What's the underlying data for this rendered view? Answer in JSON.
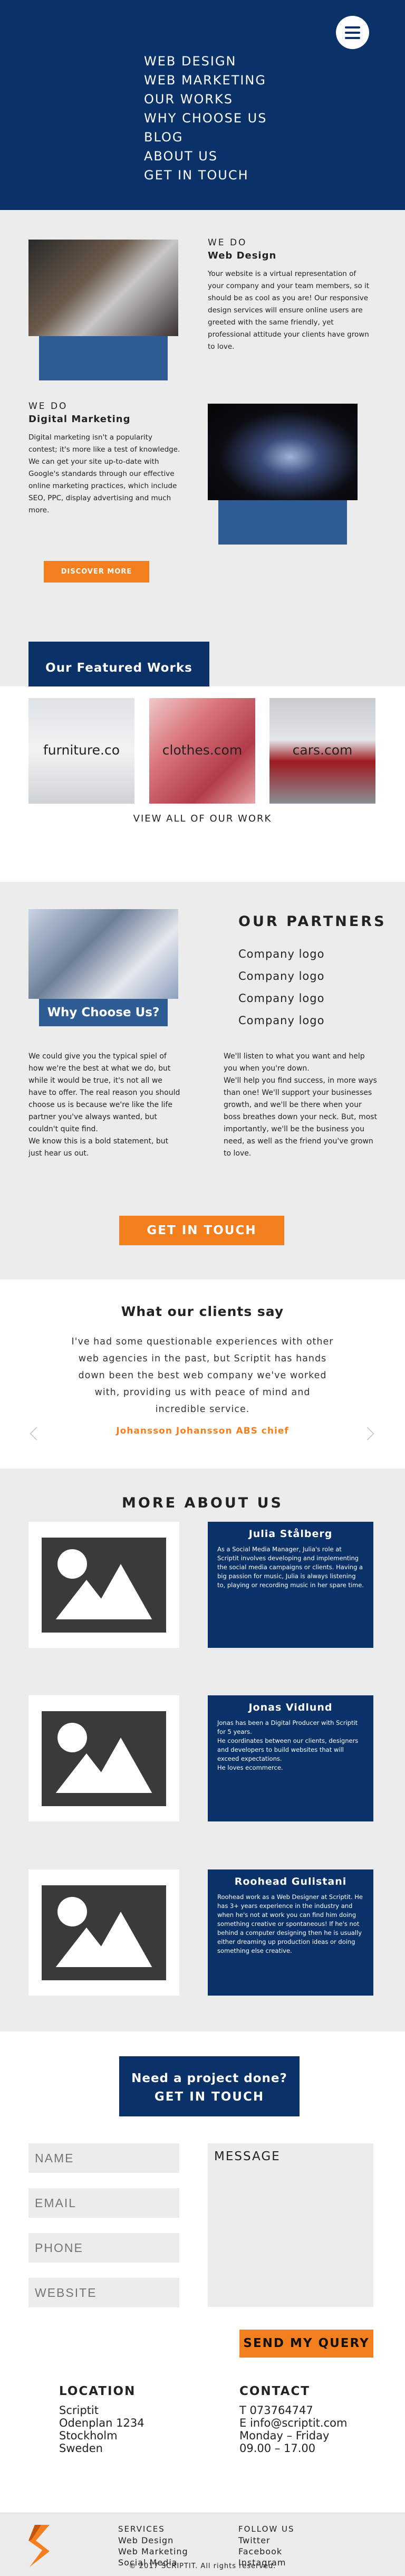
{
  "nav": {
    "items": [
      "WEB DESIGN",
      "WEB MARKETING",
      "OUR WORKS",
      "WHY CHOOSE US",
      "BLOG",
      "ABOUT US",
      "GET IN TOUCH"
    ]
  },
  "services": {
    "web": {
      "kicker": "WE DO",
      "title": "Web Design",
      "text": "Your website is a virtual representation of your company and your team members, so it should be as cool as you are! Our responsive design services will ensure online users are greeted with the same friendly, yet professional attitude your clients have grown to love."
    },
    "marketing": {
      "kicker": "WE DO",
      "title": "Digital Marketing",
      "text": "Digital marketing isn't a popularity contest; it's more like a test of knowledge. We can get your site up-to-date with Google's standards through our effective online marketing practices, which include SEO, PPC, display advertising and much more."
    },
    "discover": "DISCOVER MORE",
    "featured": "Our Featured Works"
  },
  "works": {
    "items": [
      "furniture.co",
      "clothes.com",
      "cars.com"
    ],
    "view_all": "VIEW ALL OF OUR WORK"
  },
  "why": {
    "button": "Why Choose Us?",
    "partners_title": "OUR PARTNERS",
    "partners": [
      "Company logo",
      "Company logo",
      "Company logo",
      "Company logo"
    ],
    "left": "We could give you the typical spiel of how we're the best at what we do, but while it would be true, it's not all we have to offer. The real reason you should choose us is because we're like the life partner you've always wanted, but couldn't quite find.\nWe know this is a bold statement, but just hear us out.",
    "right": "We'll listen to what you want and help you when you're down.\nWe'll help you find success, in more ways than one! We'll support your businesses growth, and we'll be there when your boss breathes down your neck. But, most importantly, we'll be the business you need, as well as the friend you've grown to love.",
    "git": "GET IN TOUCH"
  },
  "clients": {
    "title": "What our clients say",
    "quote": "I've had some questionable experiences with other web agencies in the past, but Scriptit has hands down been the best web company we've worked with, providing us with peace of mind and incredible service.",
    "author": "Johansson Johansson ABS chief"
  },
  "about": {
    "title": "MORE ABOUT US",
    "people": [
      {
        "name": "Julia Stålberg",
        "bio": "As a Social Media Manager, Julia's role at Scriptit involves developing and implementing the social media campaigns or clients. Having a big passion for music, Julia is always listening to, playing or recording music in her spare time."
      },
      {
        "name": "Jonas Vidlund",
        "bio": "Jonas has been a Digital Producer with Scriptit for 5 years.\nHe coordinates between our clients, designers and developers to build websites that will exceed expectations.\nHe loves ecommerce."
      },
      {
        "name": "Roohead Gulistani",
        "bio": "Roohead work as a Web Designer at Scriptit. He has 3+ years experience in the industry and when he's not at work you can find him doing something creative or spontaneous! If he's not behind a computer designing then he is usually either dreaming up production ideas or doing something else creative."
      }
    ]
  },
  "contact": {
    "need": "Need a project done?",
    "get": "GET IN TOUCH",
    "fields": [
      "NAME",
      "EMAIL",
      "PHONE",
      "WEBSITE"
    ],
    "message": "MESSAGE",
    "send": "SEND MY QUERY",
    "location": {
      "title": "LOCATION",
      "lines": [
        "Scriptit",
        "Odenplan 1234",
        "Stockholm",
        "Sweden"
      ]
    },
    "contact": {
      "title": "CONTACT",
      "lines": [
        "T 073764747",
        "E info@scriptit.com",
        "Monday – Friday",
        "09.00 – 17.00"
      ]
    }
  },
  "footer": {
    "services": {
      "title": "SERVICES",
      "items": [
        "Web Design",
        "Web Marketing",
        "Social Media"
      ]
    },
    "follow": {
      "title": "FOLLOW US",
      "items": [
        "Twitter",
        "Facebook",
        "Instagram"
      ]
    },
    "copyright": "© 2017 SCRIPTIT. All rights reserved."
  },
  "colors": {
    "navy": "#0b3268",
    "navy_light": "#2f5c94",
    "orange": "#f47f1f",
    "grey": "#ececec"
  },
  "icons": [
    "menu-icon",
    "image-placeholder-icon",
    "chevron-left-icon",
    "chevron-right-icon",
    "scriptit-logo"
  ]
}
